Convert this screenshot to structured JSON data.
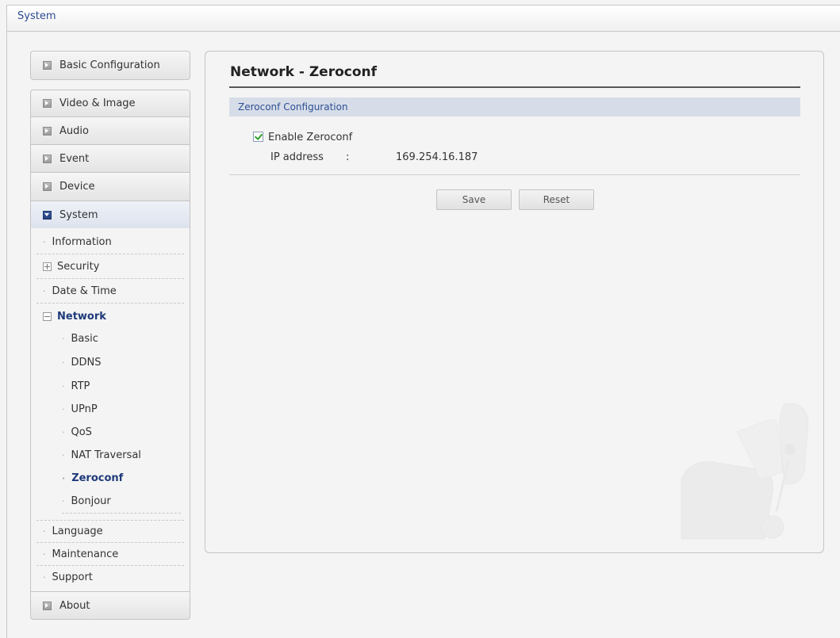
{
  "header": {
    "title": "System"
  },
  "sidebar": {
    "basic_configuration": "Basic Configuration",
    "video_image": "Video & Image",
    "audio": "Audio",
    "event": "Event",
    "device": "Device",
    "system": "System",
    "about": "About",
    "system_items": {
      "information": "Information",
      "security": "Security",
      "date_time": "Date & Time",
      "network": "Network",
      "language": "Language",
      "maintenance": "Maintenance",
      "support": "Support"
    },
    "network_items": [
      "Basic",
      "DDNS",
      "RTP",
      "UPnP",
      "QoS",
      "NAT Traversal",
      "Zeroconf",
      "Bonjour"
    ]
  },
  "main": {
    "title": "Network - Zeroconf",
    "section_title": "Zeroconf Configuration",
    "enable_label": "Enable Zeroconf",
    "enable_checked": true,
    "ip_label": "IP address",
    "ip_separator": ":",
    "ip_value": "169.254.16.187",
    "save_label": "Save",
    "reset_label": "Reset"
  },
  "colors": {
    "accent": "#2d4f94",
    "active_link": "#1f3a7a",
    "section_bar": "#d7dde8",
    "check": "#2ea02e"
  }
}
